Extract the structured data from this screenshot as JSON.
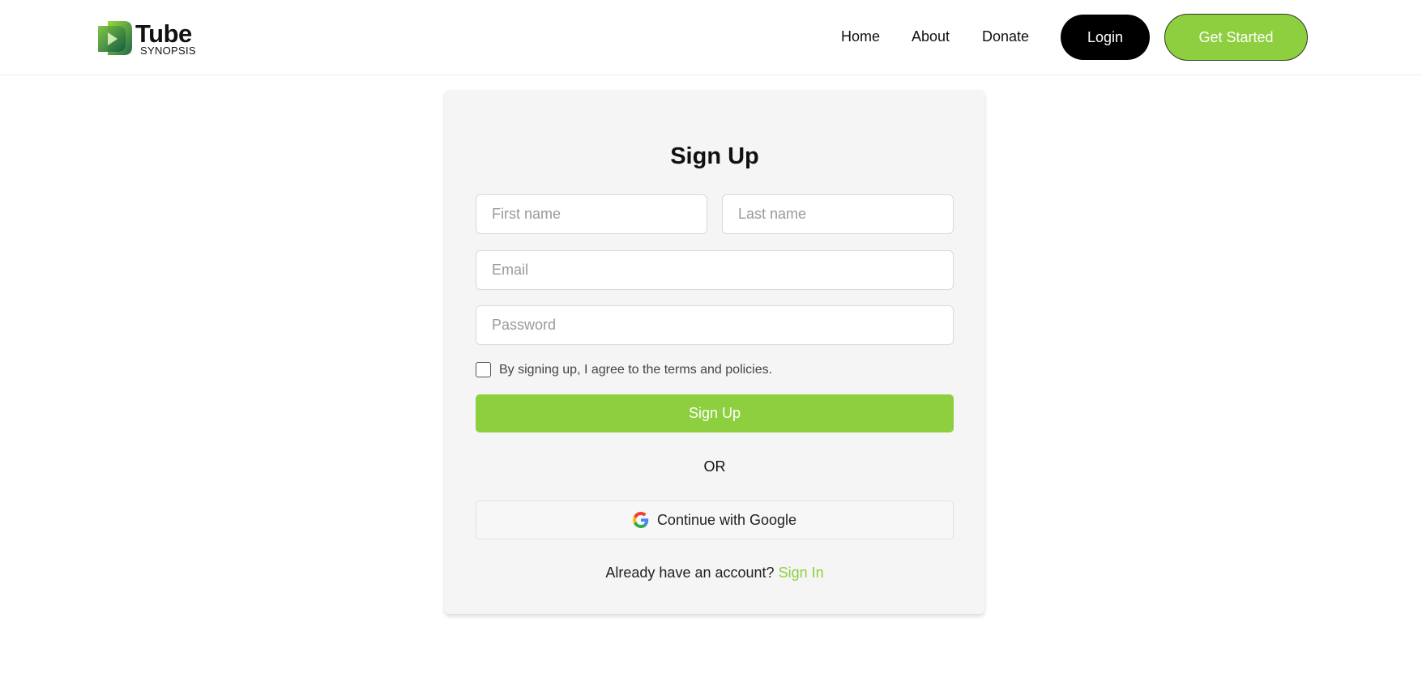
{
  "brand": {
    "name": "Tube",
    "tagline": "SYNOPSIS"
  },
  "nav": {
    "home": "Home",
    "about": "About",
    "donate": "Donate",
    "login": "Login",
    "get_started": "Get Started"
  },
  "form": {
    "title": "Sign Up",
    "first_name_placeholder": "First name",
    "last_name_placeholder": "Last name",
    "email_placeholder": "Email",
    "password_placeholder": "Password",
    "terms_label": "By signing up, I agree to the terms and policies.",
    "submit_label": "Sign Up",
    "divider": "OR",
    "google_label": "Continue with Google",
    "signin_prompt": "Already have an account?",
    "signin_link": "Sign In"
  },
  "colors": {
    "accent": "#8dcf3f",
    "dark": "#000000",
    "card": "#f5f5f5"
  },
  "icons": {
    "logo": "tube-synopsis-logo-icon",
    "google": "google-icon"
  }
}
